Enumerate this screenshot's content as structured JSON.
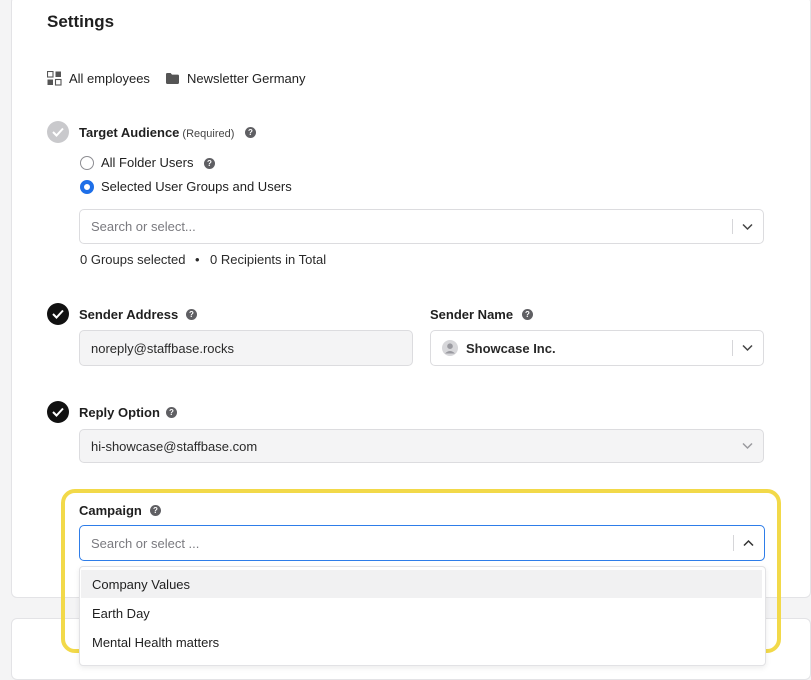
{
  "page": {
    "title": "Settings"
  },
  "breadcrumb": {
    "scope_label": "All employees",
    "folder_label": "Newsletter Germany"
  },
  "target_audience": {
    "label": "Target Audience",
    "required_note": "(Required)",
    "options": [
      {
        "label": "All Folder Users",
        "selected": false
      },
      {
        "label": "Selected User Groups and Users",
        "selected": true
      }
    ],
    "search_placeholder": "Search or select...",
    "groups_selected": "0 Groups selected",
    "separator": "•",
    "recipients_total": "0 Recipients in Total"
  },
  "sender_address": {
    "label": "Sender Address",
    "value": "noreply@staffbase.rocks"
  },
  "sender_name": {
    "label": "Sender Name",
    "value": "Showcase Inc."
  },
  "reply_option": {
    "label": "Reply Option",
    "value": "hi-showcase@staffbase.com"
  },
  "campaign": {
    "label": "Campaign",
    "search_placeholder": "Search or select ...",
    "options": [
      "Company Values",
      "Earth Day",
      "Mental Health matters"
    ]
  },
  "colors": {
    "accent_blue": "#1e6fe8",
    "highlight_yellow": "#f2d949",
    "done_step": "#111111",
    "pending_step": "#c9c9cc"
  }
}
